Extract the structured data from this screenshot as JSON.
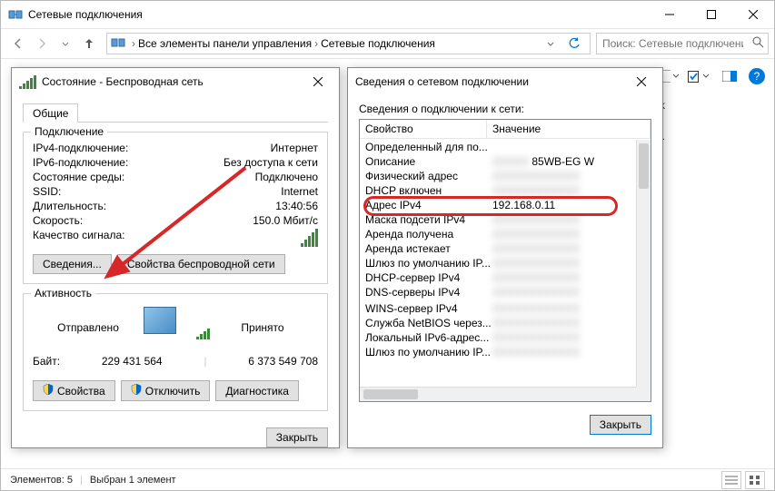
{
  "main_window": {
    "title": "Сетевые подключения",
    "breadcrumb": [
      "Все элементы панели управления",
      "Сетевые подключения"
    ],
    "search_placeholder": "Поиск: Сетевые подключения",
    "status_items": "Элементов: 5",
    "status_selected": "Выбран 1 элемент",
    "bg_line1": "rk",
    "bg_line2": "et Ad..."
  },
  "status_dialog": {
    "title": "Состояние - Беспроводная сеть",
    "tab": "Общие",
    "group_conn": "Подключение",
    "rows": {
      "ipv4_label": "IPv4-подключение:",
      "ipv4_value": "Интернет",
      "ipv6_label": "IPv6-подключение:",
      "ipv6_value": "Без доступа к сети",
      "media_label": "Состояние среды:",
      "media_value": "Подключено",
      "ssid_label": "SSID:",
      "ssid_value": "Internet",
      "duration_label": "Длительность:",
      "duration_value": "13:40:56",
      "speed_label": "Скорость:",
      "speed_value": "150.0 Мбит/с",
      "signal_label": "Качество сигнала:"
    },
    "btn_details": "Сведения...",
    "btn_wireless": "Свойства беспроводной сети",
    "group_activity": "Активность",
    "sent_label": "Отправлено",
    "received_label": "Принято",
    "bytes_label": "Байт:",
    "bytes_sent": "229 431 564",
    "bytes_received": "6 373 549 708",
    "btn_properties": "Свойства",
    "btn_disable": "Отключить",
    "btn_diagnose": "Диагностика",
    "btn_close": "Закрыть"
  },
  "details_dialog": {
    "title": "Сведения о сетевом подключении",
    "label": "Сведения о подключении к сети:",
    "col_property": "Свойство",
    "col_value": "Значение",
    "rows": [
      {
        "p": "Определенный для по...",
        "v": ""
      },
      {
        "p": "Описание",
        "v": "85WB-EG W",
        "blur": false,
        "blur_pre": true
      },
      {
        "p": "Физический адрес",
        "v": "",
        "blur": true
      },
      {
        "p": "DHCP включен",
        "v": "",
        "blur": true
      },
      {
        "p": "Адрес IPv4",
        "v": "192.168.0.11",
        "hl": true
      },
      {
        "p": "Маска подсети IPv4",
        "v": "",
        "blur": true
      },
      {
        "p": "Аренда получена",
        "v": "",
        "blur": true
      },
      {
        "p": "Аренда истекает",
        "v": "",
        "blur": true
      },
      {
        "p": "Шлюз по умолчанию IP...",
        "v": "",
        "blur": true
      },
      {
        "p": "DHCP-сервер IPv4",
        "v": "",
        "blur": true
      },
      {
        "p": "DNS-серверы IPv4",
        "v": "",
        "blur": true
      },
      {
        "p": "",
        "v": ""
      },
      {
        "p": "WINS-сервер IPv4",
        "v": "",
        "blur": true
      },
      {
        "p": "Служба NetBIOS через...",
        "v": "",
        "blur": true
      },
      {
        "p": "Локальный IPv6-адрес...",
        "v": "",
        "blur": true
      },
      {
        "p": "Шлюз по умолчанию IP...",
        "v": "",
        "blur": true
      }
    ],
    "btn_close": "Закрыть"
  }
}
